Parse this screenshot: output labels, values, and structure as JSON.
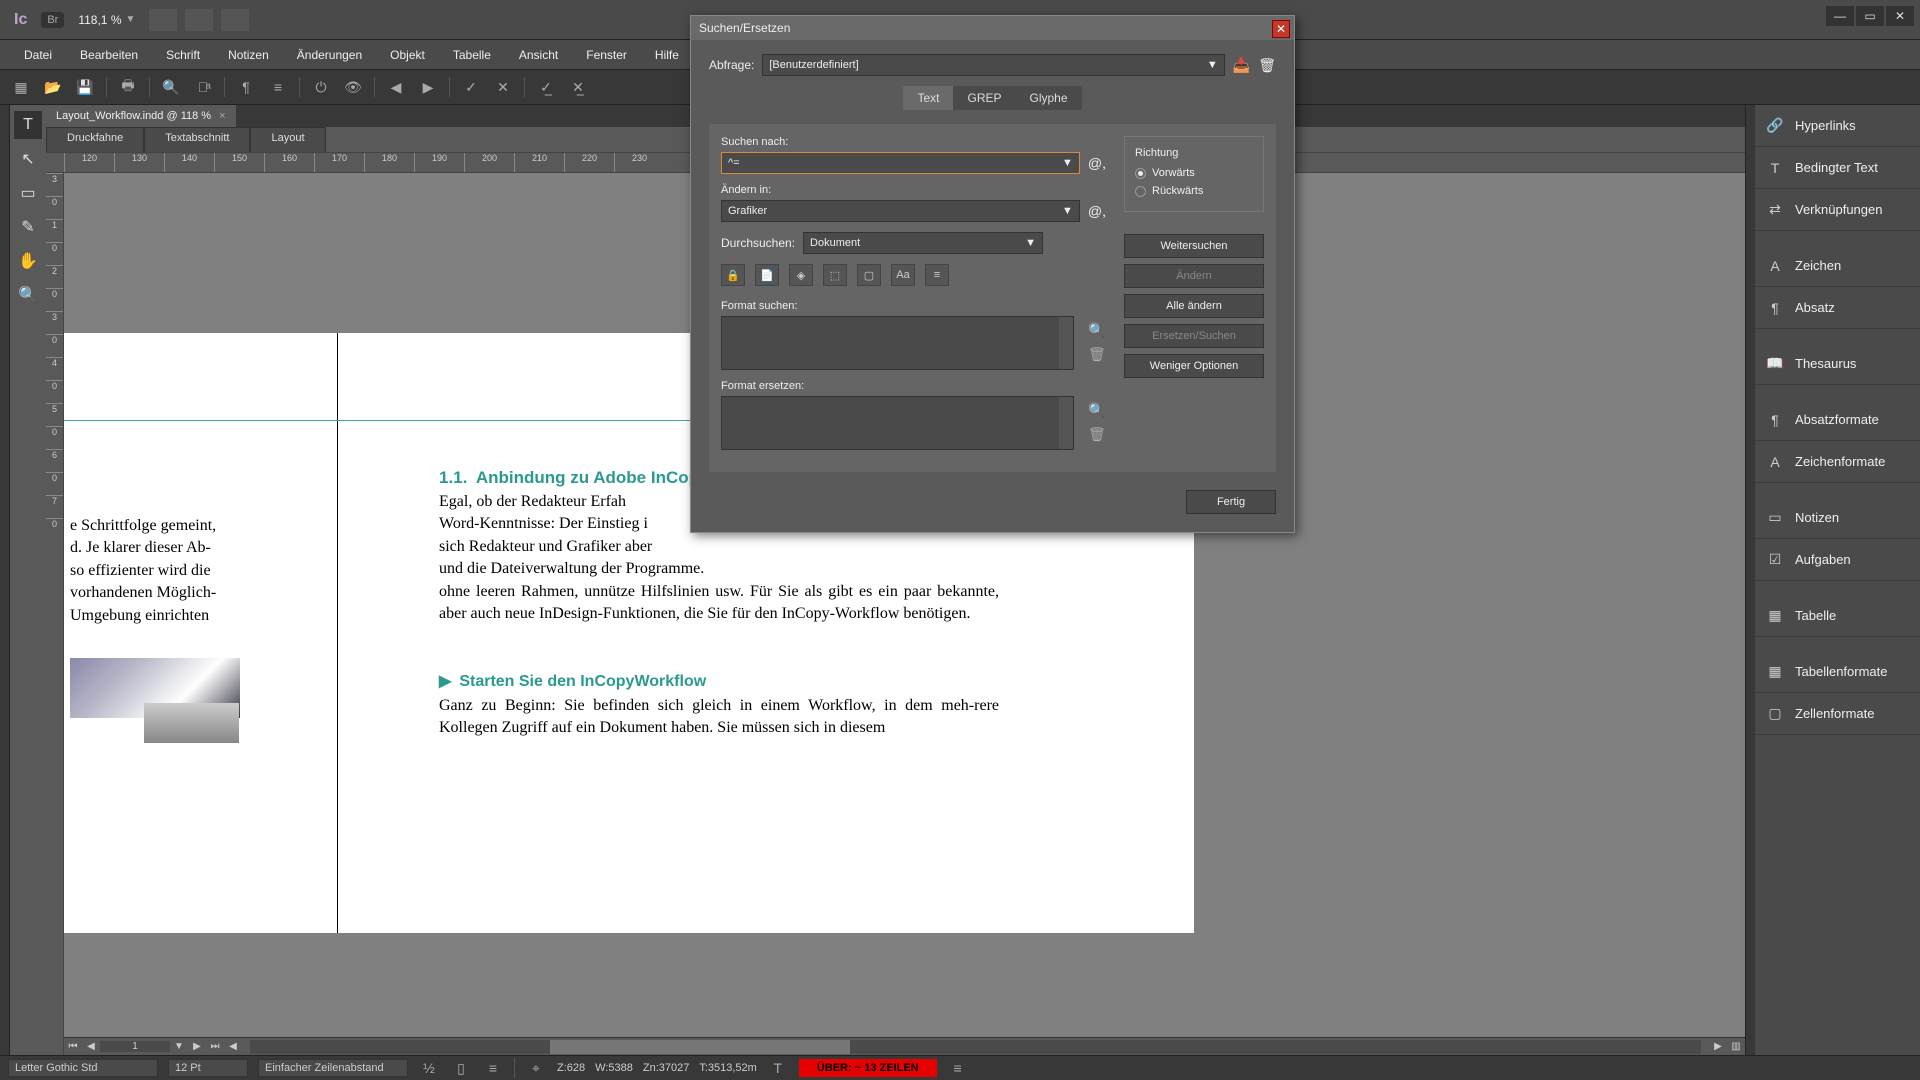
{
  "app": {
    "logo": "Ic",
    "br": "Br",
    "zoom": "118,1 %"
  },
  "menu": [
    "Datei",
    "Bearbeiten",
    "Schrift",
    "Notizen",
    "Änderungen",
    "Objekt",
    "Tabelle",
    "Ansicht",
    "Fenster",
    "Hilfe"
  ],
  "doc_tab": "Layout_Workflow.indd @ 118 %",
  "view_tabs": [
    "Druckfahne",
    "Textabschnitt",
    "Layout"
  ],
  "ruler_h": [
    "120",
    "130",
    "140",
    "150",
    "160",
    "170",
    "180",
    "190",
    "200",
    "210",
    "220",
    "230"
  ],
  "ruler_v": [
    "3",
    "0",
    "1",
    "0",
    "2",
    "0",
    "3",
    "0",
    "4",
    "0",
    "5",
    "0",
    "6",
    "0",
    "7",
    "0"
  ],
  "page": {
    "col1": "e Schrittfolge gemeint,\nd. Je klarer dieser Ab-\nso effizienter wird die\nvorhandenen Möglich-\nUmgebung einrichten",
    "h1_num": "1.1.",
    "h1": "Anbindung zu Adobe InCopy",
    "p1": "Egal, ob der Redakteur Erfah\nWord-Kenntnisse: Der Einstieg i\nsich Redakteur und Grafiker aber\nund die Dateiverwaltung der Programme.\nohne leeren Rahmen, unnütze Hilfslinien usw. Für Sie als  gibt es ein paar bekannte, aber auch neue InDesign-Funktionen, die Sie für den InCopy-Workflow benötigen.",
    "h2_tri": "▶",
    "h2": "Starten Sie den InCopyWorkflow",
    "p2": "Ganz zu Beginn: Sie befinden sich gleich in einem Workflow, in dem meh-rere Kollegen Zugriff auf ein Dokument haben. Sie müssen sich in diesem"
  },
  "dialog": {
    "title": "Suchen/Ersetzen",
    "abfrage_lbl": "Abfrage:",
    "abfrage_val": "[Benutzerdefiniert]",
    "tabs": [
      "Text",
      "GREP",
      "Glyphe"
    ],
    "suchen_lbl": "Suchen nach:",
    "suchen_val": "^=",
    "aendern_lbl": "Ändern in:",
    "aendern_val": "Grafiker",
    "durch_lbl": "Durchsuchen:",
    "durch_val": "Dokument",
    "fmt_s_lbl": "Format suchen:",
    "fmt_e_lbl": "Format ersetzen:",
    "richtung_lbl": "Richtung",
    "vorw": "Vorwärts",
    "rueckw": "Rückwärts",
    "btn_weiter": "Weitersuchen",
    "btn_aendern": "Ändern",
    "btn_alle": "Alle ändern",
    "btn_ers": "Ersetzen/Suchen",
    "btn_wenig": "Weniger Optionen",
    "btn_fertig": "Fertig"
  },
  "panels": [
    "Hyperlinks",
    "Bedingter Text",
    "Verknüpfungen",
    "Zeichen",
    "Absatz",
    "Thesaurus",
    "Absatzformate",
    "Zeichenformate",
    "Notizen",
    "Aufgaben",
    "Tabelle",
    "Tabellenformate",
    "Zellenformate"
  ],
  "status": {
    "font": "Letter Gothic Std",
    "size": "12 Pt",
    "leading": "Einfacher Zeilenabstand",
    "frac": "1\n2",
    "z": "Z:628",
    "w": "W:5388",
    "zn": "Zn:37027",
    "t": "T:3513,52m",
    "over": "ÜBER:  ~ 13 ZEILEN"
  },
  "pagenav": "1"
}
